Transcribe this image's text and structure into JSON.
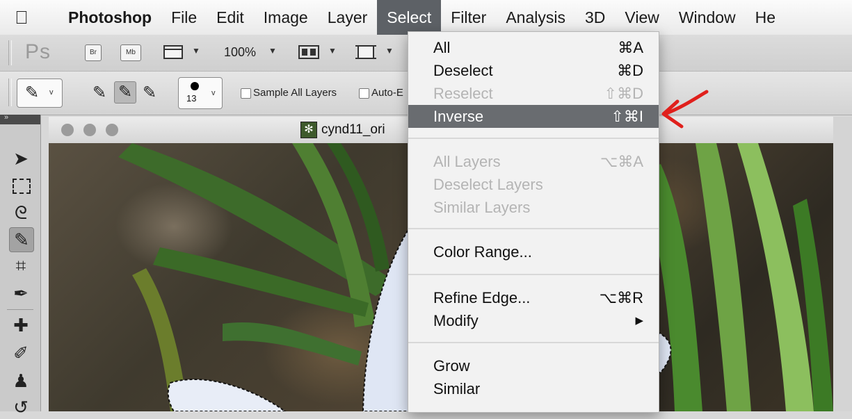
{
  "menubar": {
    "apple_icon": "apple-logo-icon",
    "app_name": "Photoshop",
    "items": [
      "File",
      "Edit",
      "Image",
      "Layer",
      "Select",
      "Filter",
      "Analysis",
      "3D",
      "View",
      "Window",
      "He"
    ],
    "active_item": "Select"
  },
  "appbar": {
    "logo": "Ps",
    "bridge_icon": "Br",
    "minibridge_icon": "Mb",
    "zoom": "100%"
  },
  "options_bar": {
    "brush_size": "13",
    "sample_all_layers": "Sample All Layers",
    "auto_enhance": "Auto-E"
  },
  "document": {
    "title": "cynd11_ori"
  },
  "select_menu": {
    "items": [
      {
        "label": "All",
        "shortcut": "⌘A",
        "enabled": true
      },
      {
        "label": "Deselect",
        "shortcut": "⌘D",
        "enabled": true
      },
      {
        "label": "Reselect",
        "shortcut": "⇧⌘D",
        "enabled": false
      },
      {
        "label": "Inverse",
        "shortcut": "⇧⌘I",
        "enabled": true,
        "highlighted": true
      },
      {
        "label": "All Layers",
        "shortcut": "⌥⌘A",
        "enabled": false
      },
      {
        "label": "Deselect Layers",
        "shortcut": "",
        "enabled": false
      },
      {
        "label": "Similar Layers",
        "shortcut": "",
        "enabled": false
      },
      {
        "label": "Color Range...",
        "shortcut": "",
        "enabled": true
      },
      {
        "label": "Refine Edge...",
        "shortcut": "⌥⌘R",
        "enabled": true
      },
      {
        "label": "Modify",
        "shortcut": "▶",
        "enabled": true
      },
      {
        "label": "Grow",
        "shortcut": "",
        "enabled": true
      },
      {
        "label": "Similar",
        "shortcut": "",
        "enabled": true
      }
    ]
  },
  "colors": {
    "menu_highlight": "#696c70",
    "menubar_active": "#5d6166",
    "annotation": "#e0201c"
  }
}
